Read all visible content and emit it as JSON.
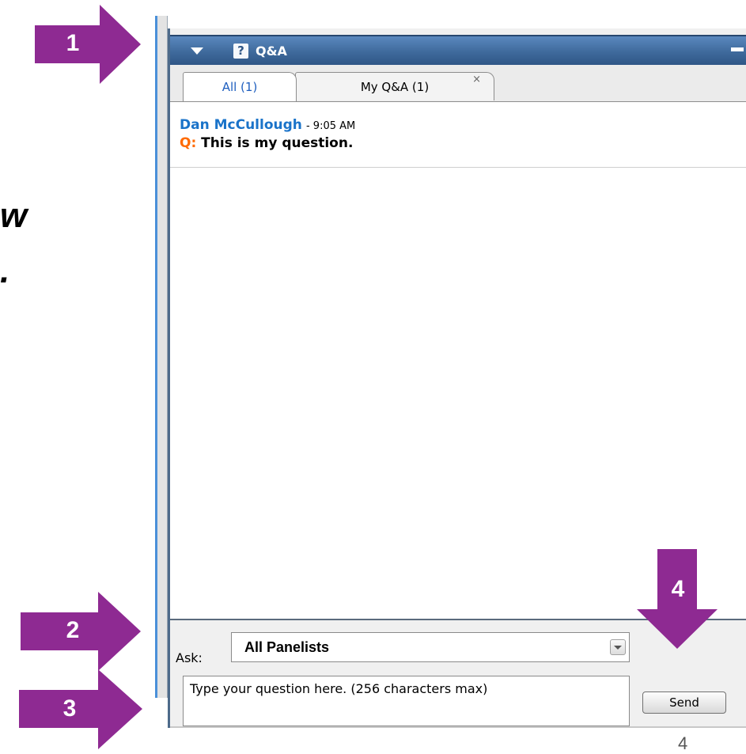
{
  "slide": {
    "partial_word": "w",
    "partial_punct": ".",
    "page_number": "4"
  },
  "qa_panel": {
    "title": "Q&A",
    "help_icon": "question-mark-icon",
    "tabs": [
      {
        "label": "All (1)"
      },
      {
        "label": "My Q&A (1)",
        "close": "×"
      }
    ],
    "questions": [
      {
        "name": "Dan McCullough",
        "time": "- 9:05 AM",
        "prefix": "Q:",
        "text": "This is my question."
      }
    ],
    "ask_label": "Ask:",
    "ask_selected": "All Panelists",
    "input_placeholder": "Type your question here. (256 characters max)",
    "send_label": "Send"
  },
  "callouts": [
    "1",
    "2",
    "3",
    "4"
  ],
  "colors": {
    "callout": "#8e2a92",
    "title_bar": "#3f6a9c",
    "name": "#1a73c9",
    "q_prefix": "#ff6a00"
  }
}
